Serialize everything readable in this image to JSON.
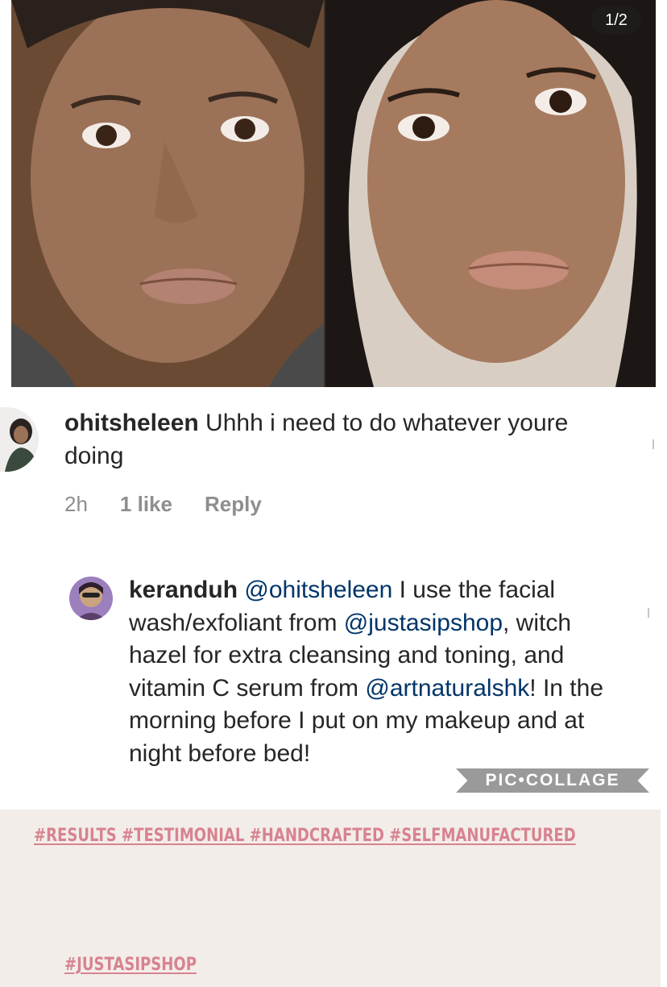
{
  "post": {
    "counter": "1/2"
  },
  "comments": [
    {
      "username": "ohitsheleen",
      "text_parts": [
        "Uhhh i need to do whatever youre doing"
      ],
      "time": "2h",
      "likes": "1 like",
      "reply": "Reply"
    },
    {
      "username": "keranduh",
      "mention_1": "@ohitsheleen",
      "text_1": " I use the facial wash/exfoliant from ",
      "mention_2": "@justasipshop",
      "text_2": ", witch hazel for extra cleansing and toning, and vitamin C serum from ",
      "mention_3": "@artnaturalshk",
      "text_3": "! In the morning before I put on my makeup and at night before bed!"
    }
  ],
  "watermark": "PIC•COLLAGE",
  "caption": {
    "tags_row_1": "#RESULTS #TESTIMONIAL  #HANDCRAFTED #SELFMANUFACTURED",
    "tags_row_2": "#JUSTASIPSHOP"
  },
  "colors": {
    "hashtag": "#d7838f",
    "caption_bg": "#f3ede9",
    "mention": "#003569",
    "meta": "#8e8e8e"
  },
  "icons": [
    "heart-like-icon",
    "avatar-ohitsheleen",
    "avatar-keranduh"
  ]
}
